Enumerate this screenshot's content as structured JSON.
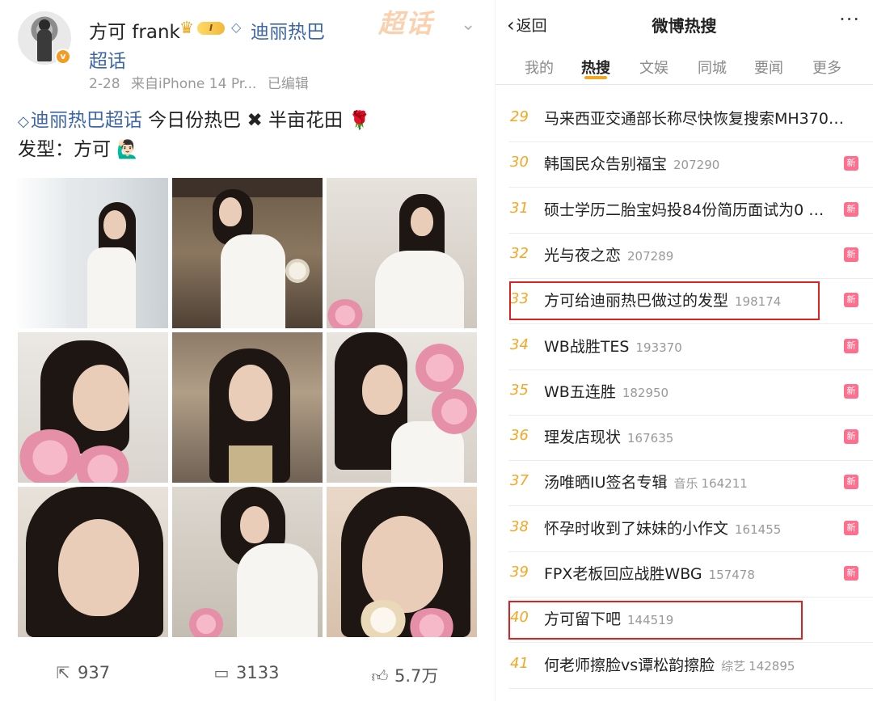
{
  "post": {
    "username": "方可 frank",
    "level_badge": "I",
    "topic_link_1": "迪丽热巴",
    "topic_link_2": "超话",
    "watermark": "超话",
    "meta_date": "2-28",
    "meta_source": "来自iPhone 14 Pr...",
    "meta_edited": "已编辑",
    "text_topic": "迪丽热巴超话",
    "text_line1": "今日份热巴 ✖ 半亩花田",
    "text_rose": "🌹",
    "text_line2": "发型：方可",
    "text_emoji": "🙋🏻‍♂️",
    "repost_count": "937",
    "comment_count": "3133",
    "like_count": "5.7万"
  },
  "hot": {
    "back_label": "返回",
    "title": "微博热搜",
    "more_label": "···",
    "tabs": [
      "我的",
      "热搜",
      "文娱",
      "同城",
      "要闻",
      "更多"
    ],
    "active_tab": "热搜",
    "new_tag": "新",
    "items": [
      {
        "rank": "29",
        "title": "马来西亚交通部长称尽快恢复搜索MH370…",
        "category": "",
        "heat": "",
        "tag": ""
      },
      {
        "rank": "30",
        "title": "韩国民众告别福宝",
        "category": "",
        "heat": "207290",
        "tag": "新"
      },
      {
        "rank": "31",
        "title": "硕士学历二胎宝妈投84份简历面试为0 …",
        "category": "",
        "heat": "",
        "tag": "新"
      },
      {
        "rank": "32",
        "title": "光与夜之恋",
        "category": "",
        "heat": "207289",
        "tag": "新"
      },
      {
        "rank": "33",
        "title": "方可给迪丽热巴做过的发型",
        "category": "",
        "heat": "198174",
        "tag": "新"
      },
      {
        "rank": "34",
        "title": "WB战胜TES",
        "category": "",
        "heat": "193370",
        "tag": "新"
      },
      {
        "rank": "35",
        "title": "WB五连胜",
        "category": "",
        "heat": "182950",
        "tag": "新"
      },
      {
        "rank": "36",
        "title": "理发店现状",
        "category": "",
        "heat": "167635",
        "tag": "新"
      },
      {
        "rank": "37",
        "title": "汤唯晒IU签名专辑",
        "category": "音乐",
        "heat": "164211",
        "tag": "新"
      },
      {
        "rank": "38",
        "title": "怀孕时收到了妹妹的小作文",
        "category": "",
        "heat": "161455",
        "tag": "新"
      },
      {
        "rank": "39",
        "title": "FPX老板回应战胜WBG",
        "category": "",
        "heat": "157478",
        "tag": "新"
      },
      {
        "rank": "40",
        "title": "方可留下吧",
        "category": "",
        "heat": "144519",
        "tag": ""
      },
      {
        "rank": "41",
        "title": "何老师擦脸vs谭松韵擦脸",
        "category": "综艺",
        "heat": "142895",
        "tag": ""
      }
    ]
  },
  "colors": {
    "link": "#3d67a8",
    "rank": "#f5a623",
    "new_tag": "#ff6f8d",
    "highlight": "#e02020"
  },
  "icons": {
    "verified": "v-badge-icon",
    "crown": "crown-icon",
    "topic": "diamond-icon",
    "repost": "share-icon",
    "comment": "comment-icon",
    "like": "thumbs-up-icon"
  }
}
